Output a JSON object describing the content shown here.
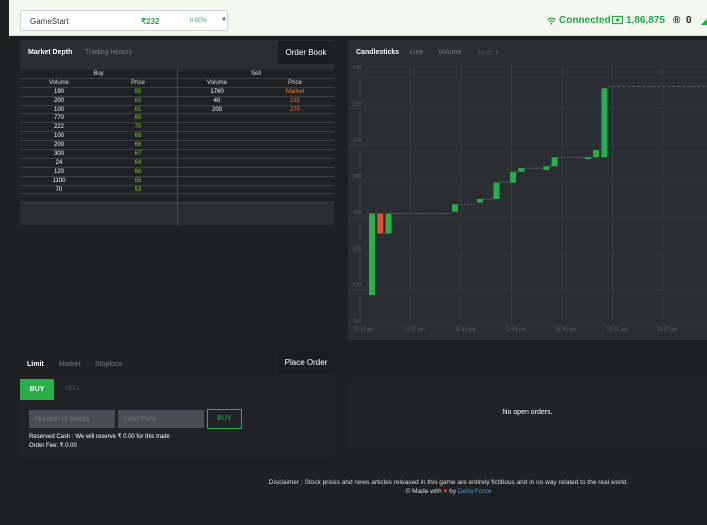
{
  "header": {
    "stock_name": "GameStart",
    "stock_price": "₹232",
    "change": "0.00%",
    "connection": "Connected",
    "cash": "1,86,875",
    "rank": "0"
  },
  "market_depth": {
    "tabs": [
      "Market Depth",
      "Trading History"
    ],
    "order_book_label": "Order Book",
    "buy_header": "Buy",
    "sell_header": "Sell",
    "col_volume": "Volume",
    "col_price": "Price",
    "buy_rows": [
      {
        "volume": "190",
        "price": "85"
      },
      {
        "volume": "200",
        "price": "82"
      },
      {
        "volume": "100",
        "price": "81"
      },
      {
        "volume": "770",
        "price": "80"
      },
      {
        "volume": "222",
        "price": "70"
      },
      {
        "volume": "100",
        "price": "69"
      },
      {
        "volume": "200",
        "price": "68"
      },
      {
        "volume": "300",
        "price": "67"
      },
      {
        "volume": "24",
        "price": "64"
      },
      {
        "volume": "120",
        "price": "60"
      },
      {
        "volume": "1100",
        "price": "55"
      },
      {
        "volume": "70",
        "price": "53"
      }
    ],
    "sell_rows": [
      {
        "volume": "1760",
        "price": "Market"
      },
      {
        "volume": "40",
        "price": "232"
      },
      {
        "volume": "200",
        "price": "270"
      }
    ]
  },
  "chart_tabs": [
    "Candlesticks",
    "Line",
    "Volume",
    "Tools ▾"
  ],
  "chart_data": {
    "type": "candlestick",
    "y_ticks": [
      240,
      220,
      200,
      180,
      160,
      140,
      120,
      100
    ],
    "ylim": [
      100,
      240
    ],
    "x_ticks": [
      "11:31 pm",
      "11:37 pm",
      "11:43 pm",
      "11:49 pm",
      "11:55 pm",
      "12:01 am",
      "12:07 am"
    ],
    "candles": [
      {
        "t": 0,
        "open": 117,
        "close": 162,
        "color": "#27b04a"
      },
      {
        "t": 1,
        "open": 162,
        "close": 151,
        "color": "#e74c3c"
      },
      {
        "t": 2,
        "open": 151,
        "close": 162,
        "color": "#27b04a"
      },
      {
        "t": 10,
        "open": 163,
        "close": 167,
        "color": "#27b04a"
      },
      {
        "t": 13,
        "open": 168,
        "close": 170,
        "color": "#27b04a"
      },
      {
        "t": 15,
        "open": 170,
        "close": 179,
        "color": "#27b04a"
      },
      {
        "t": 17,
        "open": 179,
        "close": 185,
        "color": "#27b04a"
      },
      {
        "t": 18,
        "open": 185,
        "close": 187,
        "color": "#27b04a"
      },
      {
        "t": 21,
        "open": 186,
        "close": 188,
        "color": "#27b04a"
      },
      {
        "t": 22,
        "open": 188,
        "close": 193,
        "color": "#27b04a"
      },
      {
        "t": 26,
        "open": 192,
        "close": 193,
        "color": "#27b04a"
      },
      {
        "t": 27,
        "open": 193,
        "close": 197,
        "color": "#27b04a"
      },
      {
        "t": 28,
        "open": 193,
        "close": 231,
        "color": "#27b04a"
      }
    ],
    "last_price": 232
  },
  "order": {
    "tabs": [
      "Limit",
      "Market",
      "Stoploss"
    ],
    "place_order_label": "Place Order",
    "buy_tab": "BUY",
    "sell_tab": "SELL",
    "num_placeholder": "Number of stocks",
    "price_placeholder": "Limit Price",
    "buy_button": "BUY",
    "reserved_text": "Reserved Cash : We will reserve ₹ 0.00 for this trade",
    "fee_text": "Order Fee: ₹ 0.00"
  },
  "open_orders": {
    "empty_text": "No open orders."
  },
  "footer": {
    "disclaimer": "Disclaimer : Stock prices and news articles released in this game are entirely fictitious and in no way related to the real world.",
    "made_prefix": "© Made with",
    "heart": "♥",
    "by": "by",
    "team": "Delta Force"
  }
}
